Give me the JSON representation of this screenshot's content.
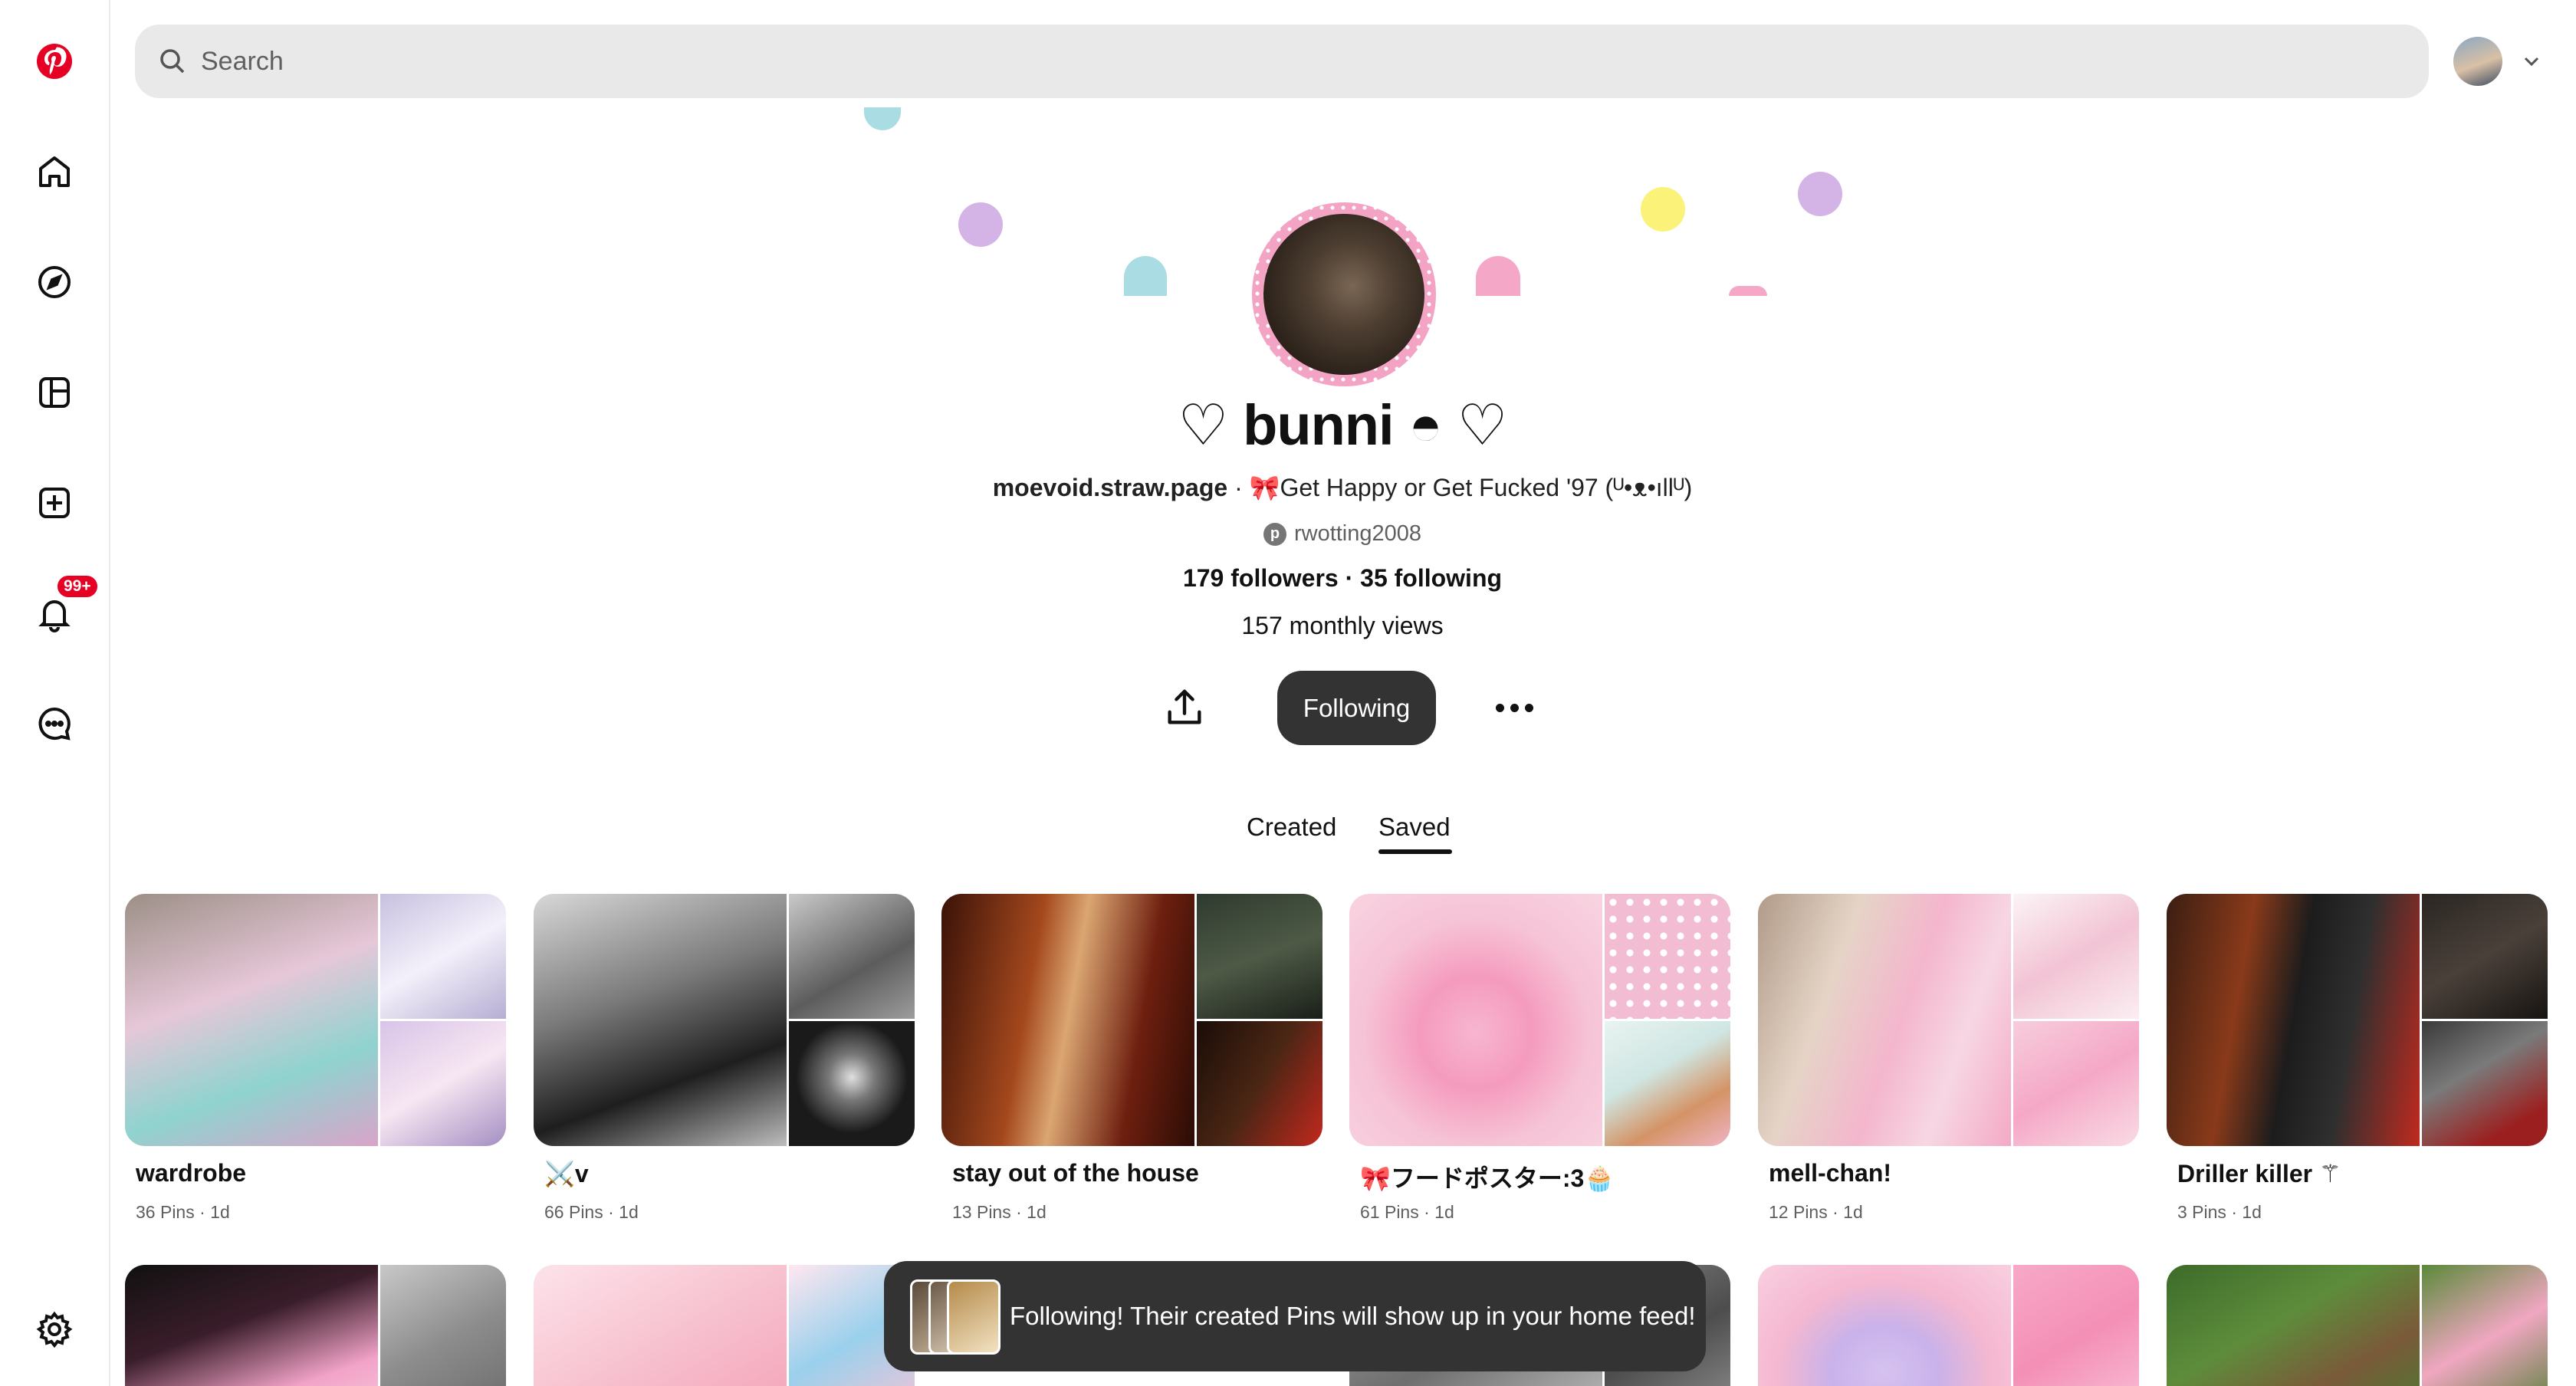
{
  "search": {
    "placeholder": "Search"
  },
  "notifications": {
    "badge": "99+"
  },
  "profile": {
    "name": "♡ bunni ◓ ♡",
    "website": "moevoid.straw.page",
    "bio": "🎀Get Happy or Get Fucked '97 (ᵁ•ᴥ•ıllᵁ)",
    "separator": " · ",
    "handle": "rwotting2008",
    "followers": "179 followers",
    "following": "35 following",
    "monthly_views": "157 monthly views"
  },
  "actions": {
    "following_label": "Following"
  },
  "tabs": [
    {
      "label": "Created"
    },
    {
      "label": "Saved"
    }
  ],
  "boards": [
    {
      "title": "wardrobe",
      "meta": "36 Pins · 1d"
    },
    {
      "title": "⚔️v",
      "meta": "66 Pins · 1d"
    },
    {
      "title": "stay out of the house",
      "meta": "13 Pins · 1d"
    },
    {
      "title": "🎀フードポスター:3🧁",
      "meta": "61 Pins · 1d"
    },
    {
      "title": "mell-chan!",
      "meta": "12 Pins · 1d"
    },
    {
      "title": "Driller killer ⚚",
      "meta": "3 Pins · 1d"
    }
  ],
  "toast": {
    "message": "Following! Their created Pins will show up in your home feed!"
  },
  "colors": {
    "brand": "#e60023",
    "button_dark": "#333333",
    "search_bg": "#e9e9e9"
  }
}
